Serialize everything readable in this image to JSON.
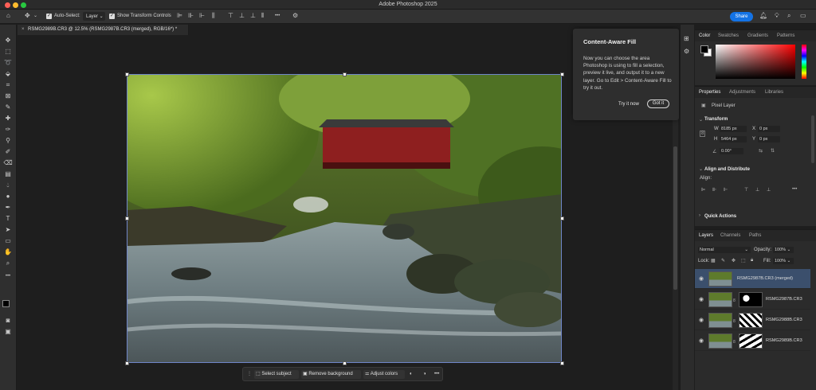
{
  "app": {
    "title": "Adobe Photoshop 2025"
  },
  "options_bar": {
    "auto_select_label": "Auto-Select:",
    "auto_select_target": "Layer",
    "show_transform_label": "Show Transform Controls",
    "more": "•••",
    "share_label": "Share"
  },
  "document": {
    "tab_title": "RSMG2989B.CR3 @ 12.5% (RSMG2987B.CR3 (merged), RGB/16*) *",
    "close": "×"
  },
  "caf_popover": {
    "title": "Content-Aware Fill",
    "body": "Now you can choose the area Photoshop is using to fill a selection, preview it live, and output it to a new layer. Go to Edit > Content-Aware Fill to try it out.",
    "try_label": "Try it now",
    "got_it_label": "Got it"
  },
  "context_bar": {
    "select_subject": "Select subject",
    "remove_background": "Remove background",
    "adjust_colors": "Adjust colors",
    "more": "•••"
  },
  "color_panel": {
    "tabs": [
      "Color",
      "Swatches",
      "Gradients",
      "Patterns"
    ],
    "active_tab": "Color",
    "foreground": "#000000",
    "background": "#ffffff",
    "hue_base": "#ff0000"
  },
  "properties_panel": {
    "tabs": [
      "Properties",
      "Adjustments",
      "Libraries"
    ],
    "layer_kind": "Pixel Layer",
    "transform_title": "Transform",
    "w_label": "W",
    "w_value": "8185 px",
    "h_label": "H",
    "h_value": "5464 px",
    "x_label": "X",
    "x_value": "0 px",
    "y_label": "Y",
    "y_value": "0 px",
    "angle_value": "0.00°",
    "align_title": "Align and Distribute",
    "align_label": "Align:",
    "quick_actions_title": "Quick Actions"
  },
  "layers_panel": {
    "tabs": [
      "Layers",
      "Channels",
      "Paths"
    ],
    "blend_mode": "Normal",
    "opacity_label": "Opacity:",
    "opacity_value": "100%",
    "lock_label": "Lock:",
    "fill_label": "Fill:",
    "fill_value": "100%",
    "layers": [
      {
        "name": "RSMG2987B.CR3 (merged)",
        "selected": true,
        "mask": false
      },
      {
        "name": "RSMG2987B.CR3",
        "selected": false,
        "mask": true
      },
      {
        "name": "RSMG2988B.CR3",
        "selected": false,
        "mask": true
      },
      {
        "name": "RSMG2989B.CR3",
        "selected": false,
        "mask": true
      }
    ]
  }
}
